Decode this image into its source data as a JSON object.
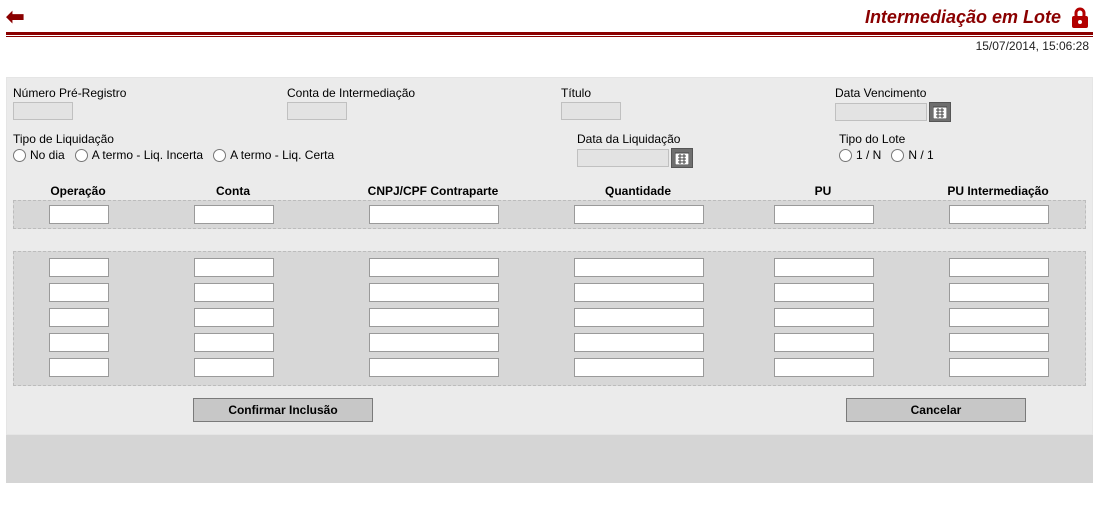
{
  "header": {
    "title": "Intermediação em Lote",
    "timestamp": "15/07/2014, 15:06:28"
  },
  "filters": {
    "numero_pre_registro": {
      "label": "Número Pré-Registro",
      "value": ""
    },
    "conta_intermediacao": {
      "label": "Conta de Intermediação",
      "value": ""
    },
    "titulo": {
      "label": "Título",
      "value": ""
    },
    "data_vencimento": {
      "label": "Data Vencimento",
      "value": ""
    },
    "tipo_liquidacao": {
      "label": "Tipo de Liquidação",
      "options": [
        "No dia",
        "A termo - Liq. Incerta",
        "A termo - Liq. Certa"
      ]
    },
    "data_liquidacao": {
      "label": "Data da Liquidação",
      "value": ""
    },
    "tipo_lote": {
      "label": "Tipo do Lote",
      "options": [
        "1 / N",
        "N / 1"
      ]
    }
  },
  "columns": [
    "Operação",
    "Conta",
    "CNPJ/CPF Contraparte",
    "Quantidade",
    "PU",
    "PU Intermediação"
  ],
  "top_row": {
    "operacao": "",
    "conta": "",
    "cnpj_cpf": "",
    "quantidade": "",
    "pu": "",
    "pu_interm": ""
  },
  "rows": [
    {
      "operacao": "",
      "conta": "",
      "cnpj_cpf": "",
      "quantidade": "",
      "pu": "",
      "pu_interm": ""
    },
    {
      "operacao": "",
      "conta": "",
      "cnpj_cpf": "",
      "quantidade": "",
      "pu": "",
      "pu_interm": ""
    },
    {
      "operacao": "",
      "conta": "",
      "cnpj_cpf": "",
      "quantidade": "",
      "pu": "",
      "pu_interm": ""
    },
    {
      "operacao": "",
      "conta": "",
      "cnpj_cpf": "",
      "quantidade": "",
      "pu": "",
      "pu_interm": ""
    },
    {
      "operacao": "",
      "conta": "",
      "cnpj_cpf": "",
      "quantidade": "",
      "pu": "",
      "pu_interm": ""
    }
  ],
  "buttons": {
    "confirm": "Confirmar Inclusão",
    "cancel": "Cancelar"
  }
}
